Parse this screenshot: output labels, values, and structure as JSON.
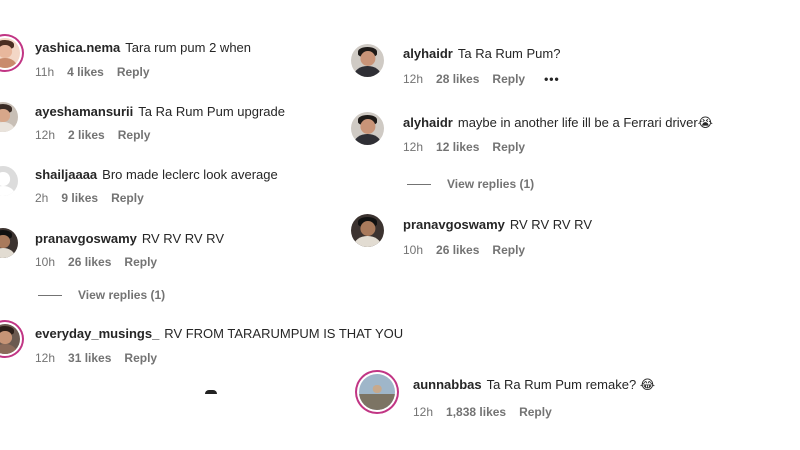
{
  "left": [
    {
      "username": "yashica.nema",
      "text": "Tara rum pum 2 when",
      "time": "11h",
      "likes": "4 likes",
      "reply": "Reply"
    },
    {
      "username": "ayeshamansurii",
      "text": "Ta Ra Rum Pum upgrade",
      "time": "12h",
      "likes": "2 likes",
      "reply": "Reply"
    },
    {
      "username": "shailjaaaa",
      "text": "Bro made leclerc look average",
      "time": "2h",
      "likes": "9 likes",
      "reply": "Reply"
    },
    {
      "username": "pranavgoswamy",
      "text": "RV RV RV RV",
      "time": "10h",
      "likes": "26 likes",
      "reply": "Reply",
      "view_replies": "View replies (1)"
    },
    {
      "username": "everyday_musings_",
      "text": "RV FROM TARARUMPUM IS THAT YOU",
      "time": "12h",
      "likes": "31 likes",
      "reply": "Reply"
    }
  ],
  "right": [
    {
      "username": "alyhaidr",
      "text": "Ta Ra Rum Pum?",
      "time": "12h",
      "likes": "28 likes",
      "reply": "Reply",
      "more": "•••"
    },
    {
      "username": "alyhaidr",
      "text": "maybe in another life ill be a Ferrari driver",
      "emoji": "😭",
      "time": "12h",
      "likes": "12 likes",
      "reply": "Reply",
      "view_replies": "View replies (1)"
    },
    {
      "username": "pranavgoswamy",
      "text": "RV RV RV RV",
      "time": "10h",
      "likes": "26 likes",
      "reply": "Reply"
    },
    {
      "username": "aunnabbas",
      "text": "Ta Ra Rum Pum remake?",
      "emoji": "😂",
      "time": "12h",
      "likes": "1,838 likes",
      "reply": "Reply"
    }
  ]
}
